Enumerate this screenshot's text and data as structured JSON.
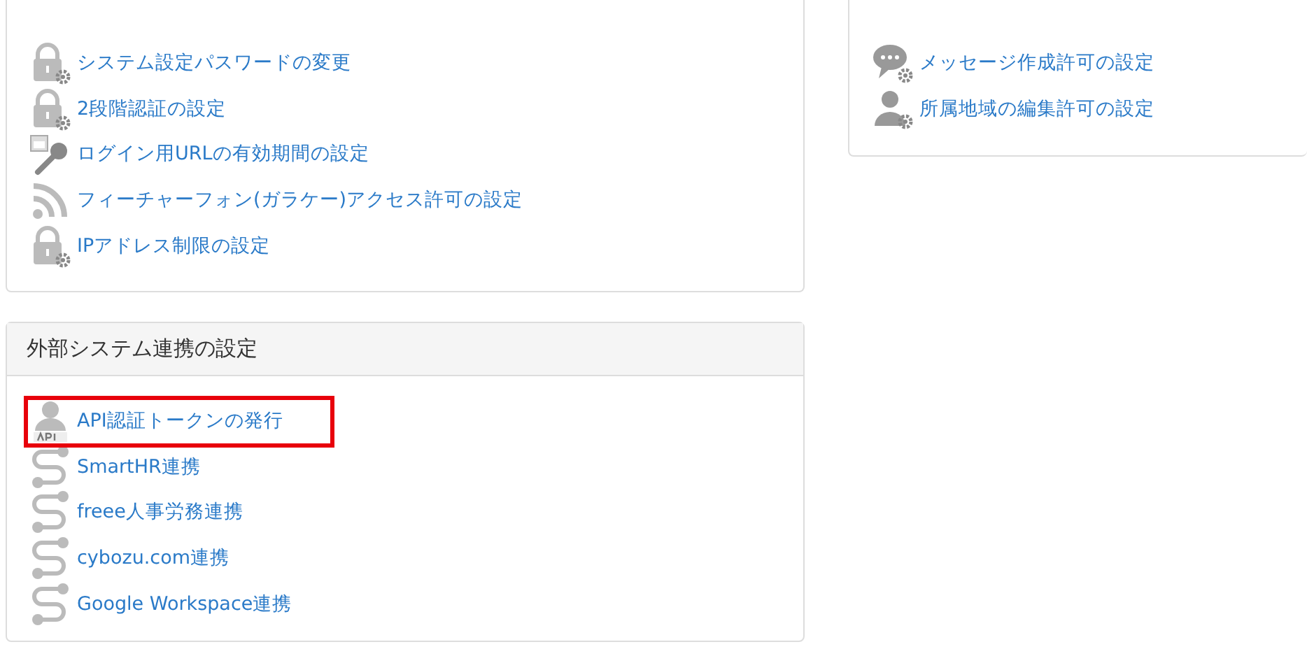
{
  "left_panels": [
    {
      "items": [
        {
          "label": "システム設定パスワードの変更",
          "kind": "lock",
          "highlighted": false
        },
        {
          "label": "2段階認証の設定",
          "kind": "lock",
          "highlighted": false
        },
        {
          "label": "ログイン用URLの有効期間の設定",
          "kind": "calendar",
          "highlighted": false
        },
        {
          "label": "フィーチャーフォン(ガラケー)アクセス許可の設定",
          "kind": "feed",
          "highlighted": false
        },
        {
          "label": "IPアドレス制限の設定",
          "kind": "lock",
          "highlighted": false
        }
      ]
    },
    {
      "title": "外部システム連携の設定",
      "items": [
        {
          "label": "API認証トークンの発行",
          "kind": "api",
          "highlighted": true
        },
        {
          "label": "SmartHR連携",
          "kind": "integration",
          "highlighted": false
        },
        {
          "label": "freee人事労務連携",
          "kind": "integration",
          "highlighted": false
        },
        {
          "label": "cybozu.com連携",
          "kind": "integration",
          "highlighted": false
        },
        {
          "label": "Google Workspace連携",
          "kind": "integration",
          "highlighted": false
        }
      ]
    }
  ],
  "right_panel": {
    "items": [
      {
        "label": "メッセージ作成許可の設定",
        "kind": "message",
        "highlighted": false
      },
      {
        "label": "所属地域の編集許可の設定",
        "kind": "member",
        "highlighted": false
      }
    ]
  }
}
